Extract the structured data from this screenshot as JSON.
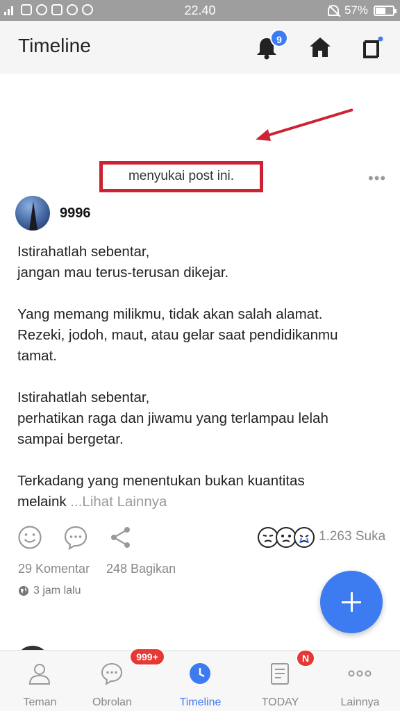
{
  "status_bar": {
    "time": "22.40",
    "battery": "57%",
    "battery_level": 0.57
  },
  "header": {
    "title": "Timeline",
    "notification_count": "9"
  },
  "post": {
    "activity_text": "menyukai post ini.",
    "author": "9996",
    "lines": [
      "Istirahatlah sebentar,",
      "jangan mau terus-terusan dikejar.",
      "",
      "Yang memang milikmu, tidak akan salah alamat.",
      "Rezeki, jodoh, maut, atau gelar saat pendidikanmu",
      "tamat.",
      "",
      "Istirahatlah sebentar,",
      "perhatikan raga dan jiwamu yang terlampau lelah",
      "sampai bergetar.",
      "",
      "Terkadang yang menentukan bukan kuantitas"
    ],
    "last_line": "melaink",
    "see_more": "...Lihat Lainnya",
    "like_count": "1.263 Suka",
    "comments": "29 Komentar",
    "shares": "248 Bagikan",
    "time_ago": "3 jam lalu"
  },
  "bottom_nav": [
    {
      "label": "Teman",
      "icon": "person-icon"
    },
    {
      "label": "Obrolan",
      "icon": "chat-icon",
      "badge": "999+"
    },
    {
      "label": "Timeline",
      "icon": "clock-icon",
      "active": true
    },
    {
      "label": "TODAY",
      "icon": "document-icon",
      "badge": "N"
    },
    {
      "label": "Lainnya",
      "icon": "more-icon"
    }
  ],
  "colors": {
    "accent": "#3d7bf0",
    "annotation": "#cc2233",
    "badge_red": "#e53935"
  }
}
